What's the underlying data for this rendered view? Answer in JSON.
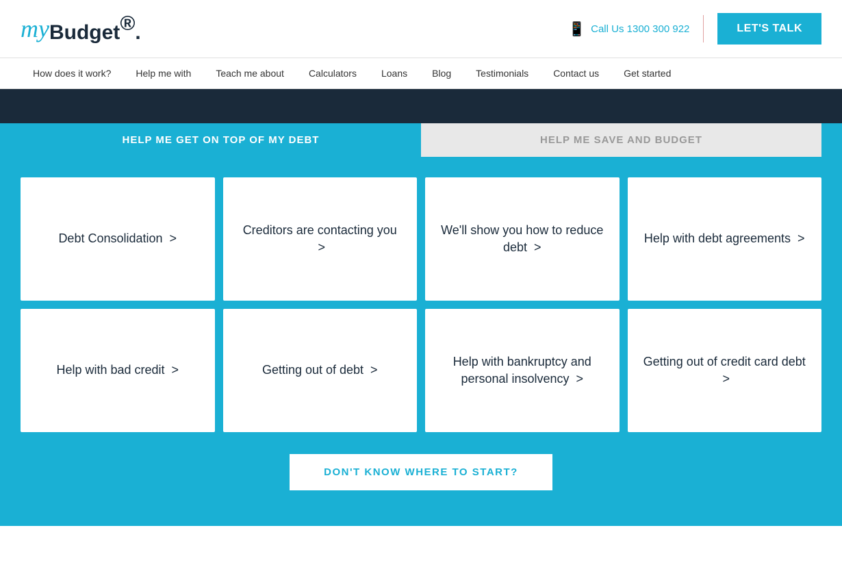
{
  "header": {
    "logo_my": "my",
    "logo_budget": "Budget",
    "logo_reg": "®",
    "phone_label": "Call Us 1300 300 922",
    "lets_talk": "Let's Talk"
  },
  "nav": {
    "items": [
      {
        "label": "How does it work?"
      },
      {
        "label": "Help me with"
      },
      {
        "label": "Teach me about"
      },
      {
        "label": "Calculators"
      },
      {
        "label": "Loans"
      },
      {
        "label": "Blog"
      },
      {
        "label": "Testimonials"
      },
      {
        "label": "Contact us"
      },
      {
        "label": "Get started"
      }
    ]
  },
  "tabs": {
    "active": "HELP ME GET ON TOP OF MY DEBT",
    "inactive": "HELP ME SAVE AND BUDGET"
  },
  "cards_row1": [
    {
      "label": "Debt Consolidation  >"
    },
    {
      "label": "Creditors are contacting you  >"
    },
    {
      "label": "We'll show you how to reduce debt  >"
    },
    {
      "label": "Help with debt agreements  >"
    }
  ],
  "cards_row2": [
    {
      "label": "Help with bad credit  >"
    },
    {
      "label": "Getting out of debt  >"
    },
    {
      "label": "Help with bankruptcy and personal insolvency  >"
    },
    {
      "label": "Getting out of credit card debt  >"
    }
  ],
  "bottom_button": "DON'T KNOW WHERE TO START?"
}
